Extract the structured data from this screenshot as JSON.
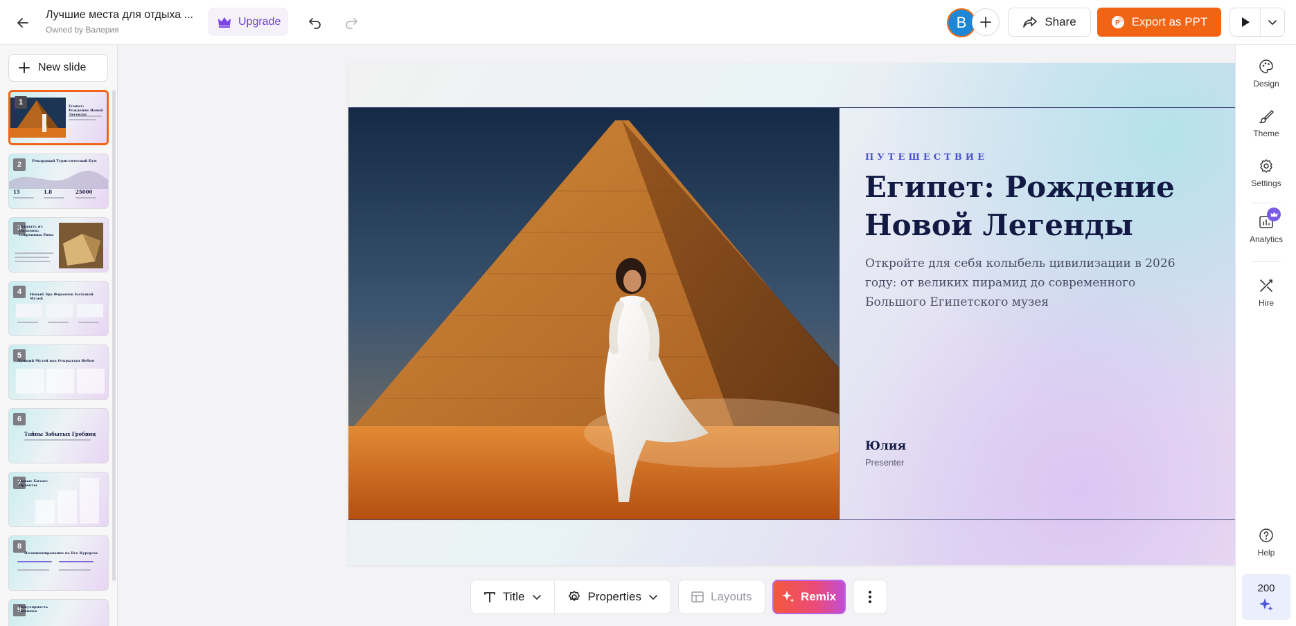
{
  "header": {
    "doc_title": "Лучшие места для отдыха ...",
    "owner": "Owned by Валерия",
    "upgrade_label": "Upgrade",
    "avatar_letter": "В",
    "share_label": "Share",
    "export_label": "Export as PPT"
  },
  "sidebar": {
    "new_slide_label": "New slide",
    "thumbnails": [
      {
        "number": "1",
        "title": "Египет: Рождение Новой Легенды",
        "active": true
      },
      {
        "number": "2",
        "title": "Рекордный Туристический Бум",
        "active": false
      },
      {
        "number": "3",
        "title": "Открыть из Раскопок: Сокровища Рима",
        "active": false
      },
      {
        "number": "4",
        "title": "Новый Эра Фараонов Большой Музей",
        "active": false
      },
      {
        "number": "5",
        "title": "Лучший Музей под Открытым Небом",
        "active": false
      },
      {
        "number": "6",
        "title": "Тайны Забытых Гробниц",
        "active": false
      },
      {
        "number": "7",
        "title": "Новые Бизнес Проекты",
        "active": false
      },
      {
        "number": "8",
        "title": "Позиционирование на Все Курорты",
        "active": false
      },
      {
        "number": "9",
        "title": "Популярность Новинки",
        "active": false
      }
    ],
    "thumb_stats": [
      "15",
      "1.8",
      "25000"
    ]
  },
  "slide": {
    "kicker": "ПУТЕШЕСТВИЕ",
    "title": "Египет: Рождение Новой Легенды",
    "subtitle": "Откройте для себя колыбель цивилизации в 2026 году: от великих пирамид до современного Большого Египетского музея",
    "presenter_name": "Юлия",
    "presenter_role": "Presenter",
    "image_description": "pyramid-with-woman-in-white-dress"
  },
  "toolbar": {
    "title_label": "Title",
    "properties_label": "Properties",
    "layouts_label": "Layouts",
    "remix_label": "Remix"
  },
  "rail": {
    "design_label": "Design",
    "theme_label": "Theme",
    "settings_label": "Settings",
    "analytics_label": "Analytics",
    "hire_label": "Hire",
    "help_label": "Help",
    "credits": "200"
  },
  "colors": {
    "accent_orange": "#f06414",
    "upgrade_purple": "#6a3fd1",
    "slide_title": "#121a44",
    "kicker_blue": "#4d54d0"
  }
}
